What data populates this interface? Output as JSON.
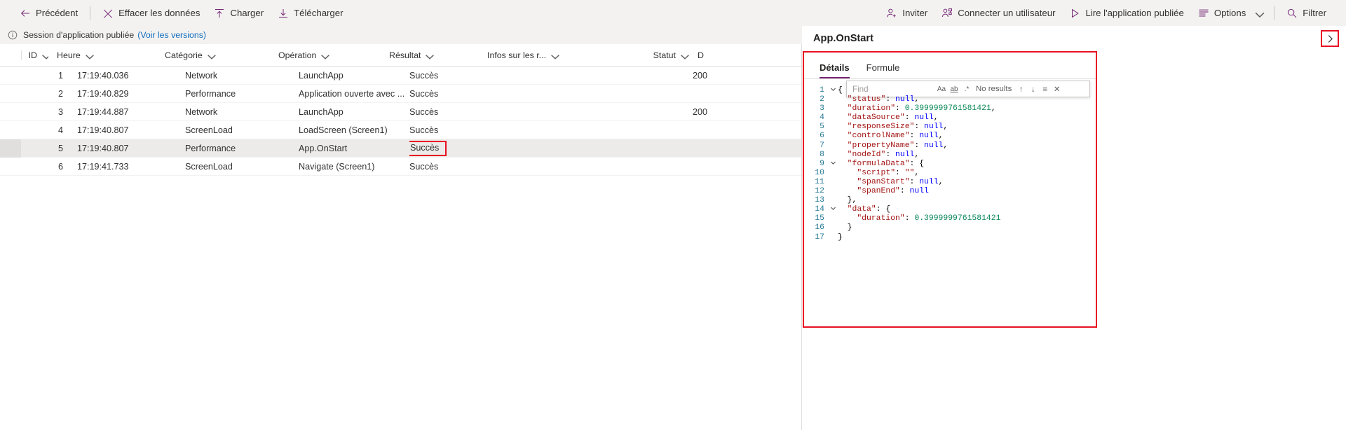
{
  "toolbar": {
    "left": [
      {
        "label": "Précédent",
        "icon": "arrow-left-icon"
      },
      {
        "label": "Effacer les données",
        "icon": "close-x-icon"
      },
      {
        "label": "Charger",
        "icon": "upload-icon"
      },
      {
        "label": "Télécharger",
        "icon": "download-icon"
      }
    ],
    "right": [
      {
        "label": "Inviter",
        "icon": "person-add-icon"
      },
      {
        "label": "Connecter un utilisateur",
        "icon": "people-icon"
      },
      {
        "label": "Lire l'application publiée",
        "icon": "play-icon"
      },
      {
        "label": "Options",
        "icon": "list-icon"
      },
      {
        "label": "Filtrer",
        "icon": "search-icon"
      }
    ]
  },
  "messagebar": {
    "icon": "info-icon",
    "text": "Session d'application publiée",
    "link": "(Voir les versions)",
    "close": "✕"
  },
  "table": {
    "columns": [
      {
        "label": "ID"
      },
      {
        "label": "Heure"
      },
      {
        "label": "Catégorie"
      },
      {
        "label": "Opération"
      },
      {
        "label": "Résultat"
      },
      {
        "label": "Infos sur les r..."
      },
      {
        "label": "Statut"
      },
      {
        "label": "D"
      }
    ],
    "rows": [
      {
        "id": "1",
        "heure": "17:19:40.036",
        "categorie": "Network",
        "operation": "LaunchApp",
        "resultat": "Succès",
        "infos": "",
        "statut": "200",
        "d": ""
      },
      {
        "id": "2",
        "heure": "17:19:40.829",
        "categorie": "Performance",
        "operation": "Application ouverte avec ...",
        "resultat": "Succès",
        "infos": "",
        "statut": "",
        "d": ""
      },
      {
        "id": "3",
        "heure": "17:19:44.887",
        "categorie": "Network",
        "operation": "LaunchApp",
        "resultat": "Succès",
        "infos": "",
        "statut": "200",
        "d": ""
      },
      {
        "id": "4",
        "heure": "17:19:40.807",
        "categorie": "ScreenLoad",
        "operation": "LoadScreen (Screen1)",
        "resultat": "Succès",
        "infos": "",
        "statut": "",
        "d": ""
      },
      {
        "id": "5",
        "heure": "17:19:40.807",
        "categorie": "Performance",
        "operation": "App.OnStart",
        "resultat": "Succès",
        "infos": "",
        "statut": "",
        "d": "",
        "selected": true,
        "result_highlighted": true
      },
      {
        "id": "6",
        "heure": "17:19:41.733",
        "categorie": "ScreenLoad",
        "operation": "Navigate (Screen1)",
        "resultat": "Succès",
        "infos": "",
        "statut": "",
        "d": ""
      }
    ]
  },
  "details": {
    "title": "App.OnStart",
    "expand_icon": "chevron-right-icon",
    "tabs": [
      {
        "label": "Détails",
        "active": true
      },
      {
        "label": "Formule",
        "active": false
      }
    ],
    "find": {
      "placeholder": "Find",
      "value": "",
      "match_case": "Aa",
      "match_word": "ab",
      "use_regex": ".*",
      "results": "No results",
      "prev": "↑",
      "next": "↓",
      "selection": "≡",
      "close": "✕"
    },
    "code_lines": [
      {
        "num": "1",
        "fold": "v",
        "tokens": [
          {
            "t": "{",
            "c": "p"
          }
        ]
      },
      {
        "num": "2",
        "fold": "",
        "tokens": [
          {
            "t": "  ",
            "c": "p"
          },
          {
            "t": "\"status\"",
            "c": "k"
          },
          {
            "t": ": ",
            "c": "p"
          },
          {
            "t": "null",
            "c": "nl"
          },
          {
            "t": ",",
            "c": "p"
          }
        ]
      },
      {
        "num": "3",
        "fold": "",
        "tokens": [
          {
            "t": "  ",
            "c": "p"
          },
          {
            "t": "\"duration\"",
            "c": "k"
          },
          {
            "t": ": ",
            "c": "p"
          },
          {
            "t": "0.3999999761581421",
            "c": "n"
          },
          {
            "t": ",",
            "c": "p"
          }
        ]
      },
      {
        "num": "4",
        "fold": "",
        "tokens": [
          {
            "t": "  ",
            "c": "p"
          },
          {
            "t": "\"dataSource\"",
            "c": "k"
          },
          {
            "t": ": ",
            "c": "p"
          },
          {
            "t": "null",
            "c": "nl"
          },
          {
            "t": ",",
            "c": "p"
          }
        ]
      },
      {
        "num": "5",
        "fold": "",
        "tokens": [
          {
            "t": "  ",
            "c": "p"
          },
          {
            "t": "\"responseSize\"",
            "c": "k"
          },
          {
            "t": ": ",
            "c": "p"
          },
          {
            "t": "null",
            "c": "nl"
          },
          {
            "t": ",",
            "c": "p"
          }
        ]
      },
      {
        "num": "6",
        "fold": "",
        "tokens": [
          {
            "t": "  ",
            "c": "p"
          },
          {
            "t": "\"controlName\"",
            "c": "k"
          },
          {
            "t": ": ",
            "c": "p"
          },
          {
            "t": "null",
            "c": "nl"
          },
          {
            "t": ",",
            "c": "p"
          }
        ]
      },
      {
        "num": "7",
        "fold": "",
        "tokens": [
          {
            "t": "  ",
            "c": "p"
          },
          {
            "t": "\"propertyName\"",
            "c": "k"
          },
          {
            "t": ": ",
            "c": "p"
          },
          {
            "t": "null",
            "c": "nl"
          },
          {
            "t": ",",
            "c": "p"
          }
        ]
      },
      {
        "num": "8",
        "fold": "",
        "tokens": [
          {
            "t": "  ",
            "c": "p"
          },
          {
            "t": "\"nodeId\"",
            "c": "k"
          },
          {
            "t": ": ",
            "c": "p"
          },
          {
            "t": "null",
            "c": "nl"
          },
          {
            "t": ",",
            "c": "p"
          }
        ]
      },
      {
        "num": "9",
        "fold": "v",
        "tokens": [
          {
            "t": "  ",
            "c": "p"
          },
          {
            "t": "\"formulaData\"",
            "c": "k"
          },
          {
            "t": ": {",
            "c": "p"
          }
        ]
      },
      {
        "num": "10",
        "fold": "",
        "tokens": [
          {
            "t": "    ",
            "c": "p"
          },
          {
            "t": "\"script\"",
            "c": "k"
          },
          {
            "t": ": ",
            "c": "p"
          },
          {
            "t": "\"\"",
            "c": "s"
          },
          {
            "t": ",",
            "c": "p"
          }
        ]
      },
      {
        "num": "11",
        "fold": "",
        "tokens": [
          {
            "t": "    ",
            "c": "p"
          },
          {
            "t": "\"spanStart\"",
            "c": "k"
          },
          {
            "t": ": ",
            "c": "p"
          },
          {
            "t": "null",
            "c": "nl"
          },
          {
            "t": ",",
            "c": "p"
          }
        ]
      },
      {
        "num": "12",
        "fold": "",
        "tokens": [
          {
            "t": "    ",
            "c": "p"
          },
          {
            "t": "\"spanEnd\"",
            "c": "k"
          },
          {
            "t": ": ",
            "c": "p"
          },
          {
            "t": "null",
            "c": "nl"
          }
        ]
      },
      {
        "num": "13",
        "fold": "",
        "tokens": [
          {
            "t": "  },",
            "c": "p"
          }
        ]
      },
      {
        "num": "14",
        "fold": "v",
        "tokens": [
          {
            "t": "  ",
            "c": "p"
          },
          {
            "t": "\"data\"",
            "c": "k"
          },
          {
            "t": ": {",
            "c": "p"
          }
        ]
      },
      {
        "num": "15",
        "fold": "",
        "tokens": [
          {
            "t": "    ",
            "c": "p"
          },
          {
            "t": "\"duration\"",
            "c": "k"
          },
          {
            "t": ": ",
            "c": "p"
          },
          {
            "t": "0.3999999761581421",
            "c": "n"
          }
        ]
      },
      {
        "num": "16",
        "fold": "",
        "tokens": [
          {
            "t": "  }",
            "c": "p"
          }
        ]
      },
      {
        "num": "17",
        "fold": "",
        "tokens": [
          {
            "t": "}",
            "c": "p"
          }
        ]
      }
    ]
  },
  "colors": {
    "accent": "#742774",
    "highlight_red": "#e81123",
    "link_blue": "#0f6cbd",
    "chrome_bg": "#f3f2f1"
  }
}
